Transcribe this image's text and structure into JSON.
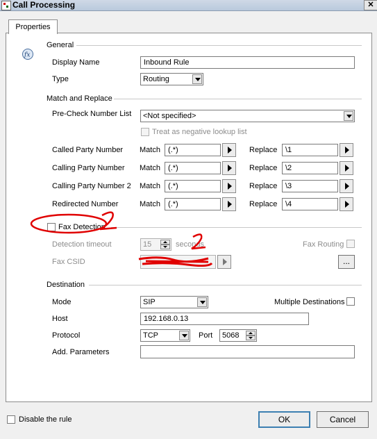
{
  "window": {
    "title": "Call Processing",
    "close_glyph": "✕"
  },
  "tabs": [
    {
      "label": "Properties"
    }
  ],
  "general": {
    "section_title": "General",
    "display_name_label": "Display Name",
    "display_name_value": "Inbound Rule",
    "type_label": "Type",
    "type_value": "Routing"
  },
  "match_replace": {
    "section_title": "Match and Replace",
    "precheck_label": "Pre-Check Number List",
    "precheck_value": "<Not specified>",
    "treat_negative_label": "Treat as negative lookup list",
    "match_label": "Match",
    "replace_label": "Replace",
    "rows": [
      {
        "label": "Called Party Number",
        "match": "(.*)",
        "replace": "\\1"
      },
      {
        "label": "Calling Party Number",
        "match": "(.*)",
        "replace": "\\2"
      },
      {
        "label": "Calling Party Number 2",
        "match": "(.*)",
        "replace": "\\3"
      },
      {
        "label": "Redirected Number",
        "match": "(.*)",
        "replace": "\\4"
      }
    ]
  },
  "fax": {
    "detection_label": "Fax Detection",
    "timeout_label": "Detection timeout",
    "timeout_value": "15",
    "seconds_label": "seconds",
    "routing_label": "Fax Routing",
    "csid_label": "Fax CSID",
    "browse_label": "..."
  },
  "destination": {
    "section_title": "Destination",
    "mode_label": "Mode",
    "mode_value": "SIP",
    "multiple_label": "Multiple Destinations",
    "host_label": "Host",
    "host_value": "192.168.0.13",
    "protocol_label": "Protocol",
    "protocol_value": "TCP",
    "port_label": "Port",
    "port_value": "5068",
    "add_params_label": "Add. Parameters",
    "add_params_value": ""
  },
  "footer": {
    "disable_label": "Disable the rule",
    "ok_label": "OK",
    "cancel_label": "Cancel"
  },
  "annotations": {
    "mark_1": "2",
    "mark_2": "2",
    "color": "#e00000"
  },
  "icons": {
    "app": "call-processing-app-icon",
    "fx": "function-fx-icon"
  }
}
